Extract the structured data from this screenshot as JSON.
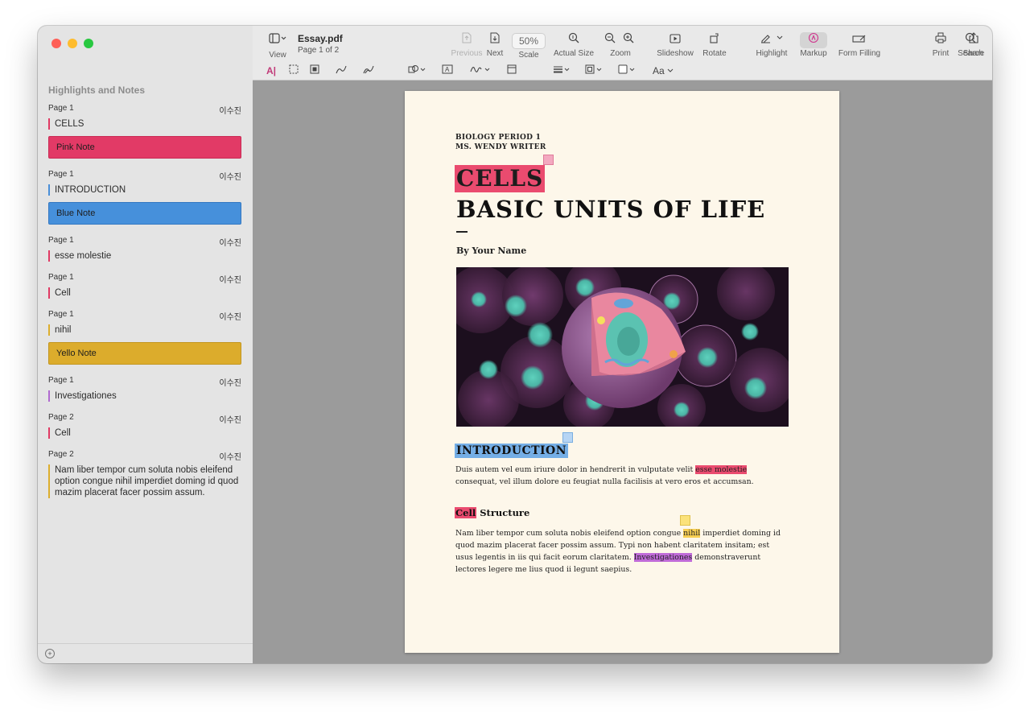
{
  "sidebar": {
    "title": "Highlights and Notes",
    "entries": [
      {
        "page": "Page 1",
        "author": "이수진",
        "text": "CELLS",
        "color": "#e03a63",
        "note": "Pink Note",
        "note_color": "#e23a66"
      },
      {
        "page": "Page 1",
        "author": "이수진",
        "text": "INTRODUCTION",
        "color": "#4a8fd8",
        "note": "Blue Note",
        "note_color": "#4690db"
      },
      {
        "page": "Page 1",
        "author": "이수진",
        "text": "esse molestie",
        "color": "#e03a63"
      },
      {
        "page": "Page 1",
        "author": "이수진",
        "text": "Cell",
        "color": "#e03a63"
      },
      {
        "page": "Page 1",
        "author": "이수진",
        "text": "nihil",
        "color": "#dcae2e",
        "note": "Yello Note",
        "note_color": "#dcac2c"
      },
      {
        "page": "Page 1",
        "author": "이수진",
        "text": "Investigationes",
        "color": "#b06ad0"
      },
      {
        "page": "Page 2",
        "author": "이수진",
        "text": "Cell",
        "color": "#e03a63"
      },
      {
        "page": "Page 2",
        "author": "이수진",
        "text": "Nam liber tempor cum soluta nobis eleifend option congue nihil imperdiet doming id quod mazim placerat facer possim assum.",
        "color": "#dcae2e"
      }
    ]
  },
  "toolbar": {
    "view_label": "View",
    "doc_name": "Essay.pdf",
    "doc_sub": "Page 1 of 2",
    "previous_label": "Previous",
    "next_label": "Next",
    "scale_value": "50%",
    "scale_label": "Scale",
    "actual_size_label": "Actual Size",
    "zoom_label": "Zoom",
    "slideshow_label": "Slideshow",
    "rotate_label": "Rotate",
    "highlight_label": "Highlight",
    "markup_label": "Markup",
    "form_filling_label": "Form Filling",
    "print_label": "Print",
    "share_label": "Share",
    "search_label": "Search",
    "font_label": "Aa"
  },
  "page": {
    "course": "BIOLOGY PERIOD 1",
    "teacher": "MS. WENDY WRITER",
    "title_hl": "CELLS",
    "title_rest": "BASIC UNITS OF LIFE",
    "byline": "By Your Name",
    "intro_heading": "INTRODUCTION",
    "p1_a": "Duis autem vel eum iriure dolor in hendrerit in vulputate velit ",
    "p1_hl": "esse molestie",
    "p1_b": " consequat, vel illum dolore eu feugiat nulla facilisis at vero eros et accumsan.",
    "cell_hl": "Cell",
    "cell_rest": " Structure",
    "p2_a": "Nam liber tempor cum soluta nobis eleifend option congue ",
    "p2_hl1": "nihil",
    "p2_b": " imperdiet doming id quod mazim placerat facer possim assum. Typi non habent claritatem insitam; est usus legentis in iis qui facit eorum claritatem. ",
    "p2_hl2": "Investigationes",
    "p2_c": " demonstraverunt lectores legere me lius quod ii legunt saepius."
  }
}
